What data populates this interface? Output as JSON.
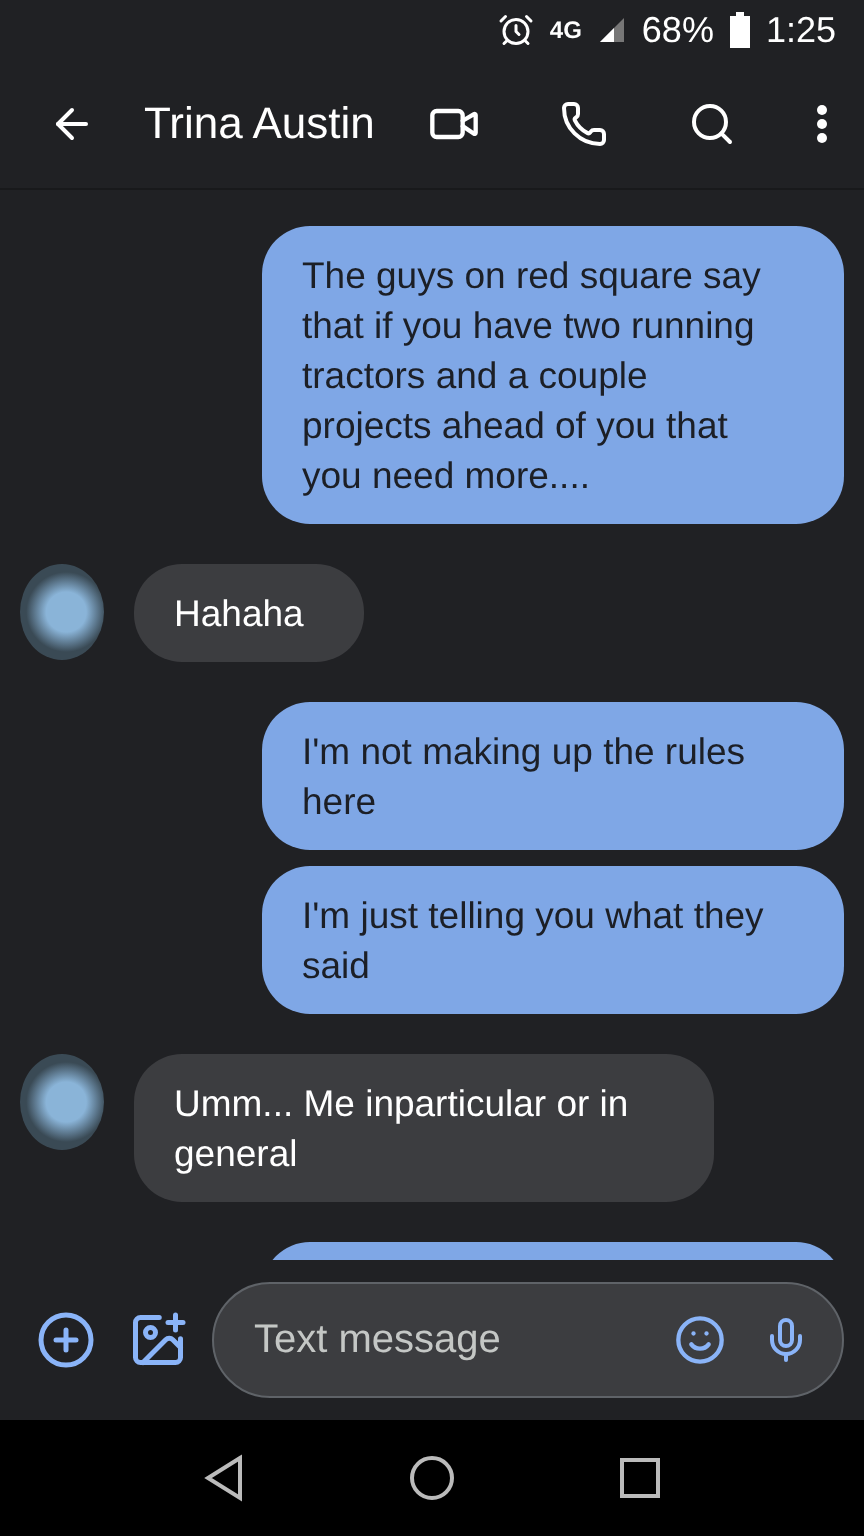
{
  "status_bar": {
    "battery": "68%",
    "time": "1:25",
    "network": "4G"
  },
  "header": {
    "title": "Trina Austin"
  },
  "messages": [
    {
      "kind": "outgoing",
      "text": "The guys on red square say that if you have two running tractors and a couple projects ahead of you that you need more...."
    },
    {
      "kind": "incoming",
      "text": "Hahaha"
    },
    {
      "kind": "outgoing",
      "text": "I'm not making up the rules here"
    },
    {
      "kind": "outgoing",
      "text": "I'm just telling you what they said"
    },
    {
      "kind": "incoming",
      "text": "Umm... Me inparticular or in general"
    },
    {
      "kind": "outgoing"
    }
  ],
  "composer": {
    "placeholder": "Text message"
  }
}
